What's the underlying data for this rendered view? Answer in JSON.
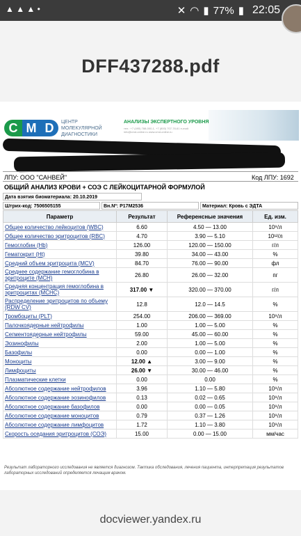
{
  "status": {
    "battery": "77%",
    "time": "22:05",
    "icons": [
      "mute-icon",
      "wifi-icon",
      "signal-icon",
      "battery-icon"
    ]
  },
  "file_title": "DFF437288.pdf",
  "header": {
    "logo": [
      "C",
      "M",
      "D"
    ],
    "center_name": "ЦЕНТР МОЛЕКУЛЯРНОЙ ДИАГНОСТИКИ",
    "expert": "АНАЛИЗЫ ЭКСПЕРТНОГО УРОВНЯ",
    "contacts": "тел.: +7 (495) 788-000-1, +7 (800) 707-78-61 e-mail: info@cmd-online.ru www.cmd-online.ru"
  },
  "lpu": {
    "label": "ЛПУ: ООО \"САНВЕЙ\"",
    "code": "Код ЛПУ: 1692"
  },
  "analysis_title": "ОБЩИЙ АНАЛИЗ КРОВИ + СОЭ С ЛЕЙКОЦИТАРНОЙ ФОРМУЛОЙ",
  "sample_date": "Дата взятия биоматериала: 20.10.2019",
  "barcode": "Штрих-код: 7506505155",
  "vn": "Вн.Nº: Р17М2536",
  "material": "Материал: Кровь с ЭДТА",
  "table": {
    "headers": [
      "Параметр",
      "Результат",
      "Референсные значения",
      "Ед. изм."
    ],
    "rows": [
      {
        "name": "Общее количество лейкоцитов (WBC)",
        "value": "6.60",
        "ref": "4.50 — 13.00",
        "unit": "10⁹/л"
      },
      {
        "name": "Общее количество эритроцитов (RBC)",
        "value": "4.70",
        "ref": "3.90 — 5.10",
        "unit": "10¹²/л"
      },
      {
        "name": "Гемоглобин (Hb)",
        "value": "126.00",
        "ref": "120.00 — 150.00",
        "unit": "г/л"
      },
      {
        "name": "Гематокрит (Ht)",
        "value": "39.80",
        "ref": "34.00 — 43.00",
        "unit": "%"
      },
      {
        "name": "Средний объем эритроцита (MCV)",
        "value": "84.70",
        "ref": "76.00 — 90.00",
        "unit": "фл"
      },
      {
        "name": "Среднее содержание гемоглобина в эритроците (MCH)",
        "value": "26.80",
        "ref": "26.00 — 32.00",
        "unit": "пг"
      },
      {
        "name": "Средняя концентрация гемоглобина в эритроцитах (MCHC)",
        "value": "317.00 ▼",
        "ref": "320.00 — 370.00",
        "unit": "г/л"
      },
      {
        "name": "Распределение эритроцитов по объему (RDW CV)",
        "value": "12.8",
        "ref": "12.0 — 14.5",
        "unit": "%"
      },
      {
        "name": "Тромбоциты (PLT)",
        "value": "254.00",
        "ref": "206.00 — 369.00",
        "unit": "10⁹/л"
      },
      {
        "name": "Палочкоядерные нейтрофилы",
        "value": "1.00",
        "ref": "1.00 — 5.00",
        "unit": "%"
      },
      {
        "name": "Сегментоядерные нейтрофилы",
        "value": "59.00",
        "ref": "45.00 — 60.00",
        "unit": "%"
      },
      {
        "name": "Эозинофилы",
        "value": "2.00",
        "ref": "1.00 — 5.00",
        "unit": "%"
      },
      {
        "name": "Базофилы",
        "value": "0.00",
        "ref": "0.00 — 1.00",
        "unit": "%"
      },
      {
        "name": "Моноциты",
        "value": "12.00 ▲",
        "ref": "3.00 — 9.00",
        "unit": "%"
      },
      {
        "name": "Лимфоциты",
        "value": "26.00 ▼",
        "ref": "30.00 — 46.00",
        "unit": "%"
      },
      {
        "name": "Плазматические клетки",
        "value": "0.00",
        "ref": "0.00",
        "unit": "%"
      },
      {
        "name": "Абсолютное содержание нейтрофилов",
        "value": "3.96",
        "ref": "1.10 — 5.80",
        "unit": "10⁹/л"
      },
      {
        "name": "Абсолютное содержание эозинофилов",
        "value": "0.13",
        "ref": "0.02 — 0.65",
        "unit": "10⁹/л"
      },
      {
        "name": "Абсолютное содержание базофилов",
        "value": "0.00",
        "ref": "0.00 — 0.05",
        "unit": "10⁹/л"
      },
      {
        "name": "Абсолютное содержание моноцитов",
        "value": "0.79",
        "ref": "0.37 — 1.26",
        "unit": "10⁹/л"
      },
      {
        "name": "Абсолютное содержание лимфоцитов",
        "value": "1.72",
        "ref": "1.10 — 3.80",
        "unit": "10⁹/л"
      },
      {
        "name": "Скорость оседания эритроцитов (СОЭ)",
        "value": "15.00",
        "ref": "0.00 — 15.00",
        "unit": "мм/час"
      }
    ]
  },
  "footnote": "Результат лабораторного исследования не является диагнозом. Тактика обследования, лечения пациента, интерпретация результатов лабораторных исследований определяется лечащим врачом.",
  "footer_url": "docviewer.yandex.ru"
}
